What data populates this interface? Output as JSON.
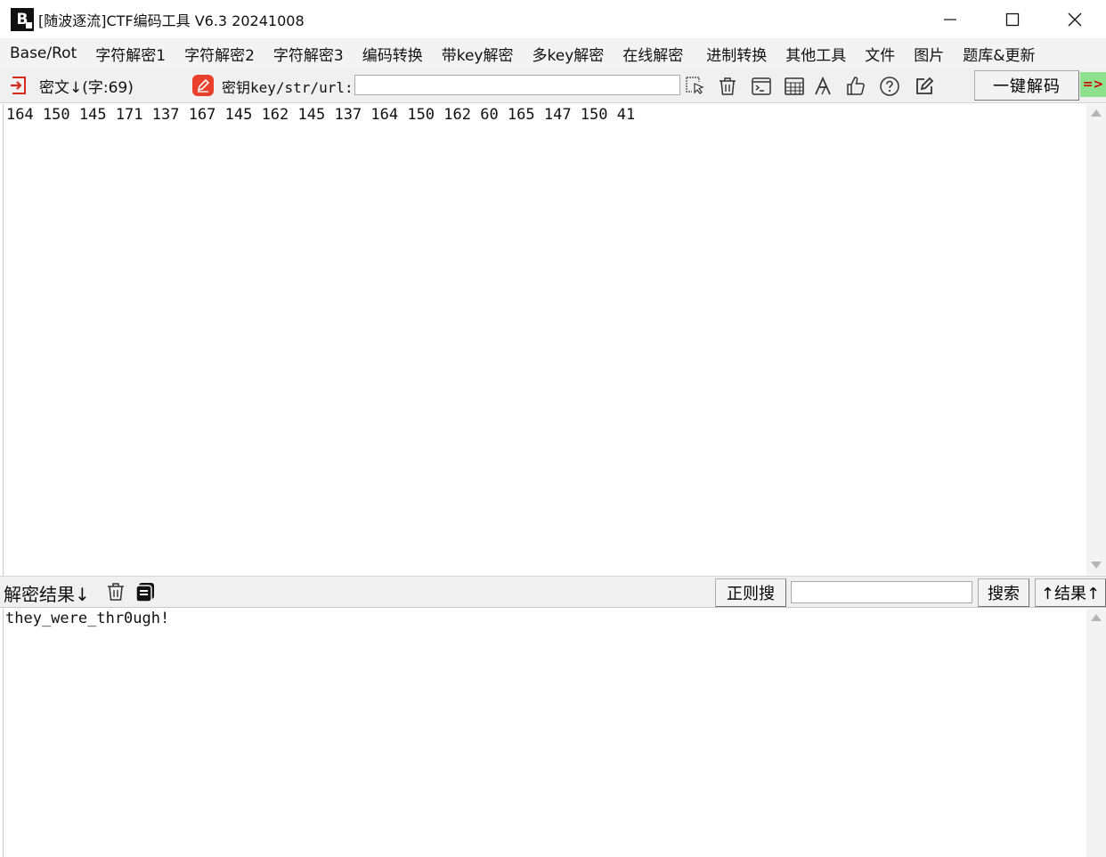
{
  "window": {
    "title": "[随波逐流]CTF编码工具 V6.3 20241008",
    "logo_text": "B"
  },
  "menu": {
    "items": [
      "Base/Rot",
      "字符解密1",
      "字符解密2",
      "字符解密3",
      "编码转换",
      "带key解密",
      "多key解密",
      "在线解密",
      "进制转换",
      "其他工具",
      "文件",
      "图片",
      "题库&更新"
    ]
  },
  "toolbar": {
    "cipher_label": "密文↓(字:69)",
    "key_label": "密钥key/str/url:",
    "key_value": "",
    "decode_button": "一键解码",
    "green_tag": "=>"
  },
  "cipher": {
    "text": "164 150 145 171 137 167 145 162 145 137 164 150 162 60 165 147 150 41"
  },
  "result": {
    "label": "解密结果↓",
    "regex_search_button": "正则搜",
    "search_value": "",
    "search_button": "搜索",
    "result_up_button": "↑结果↑",
    "text": "they_were_thr0ugh!"
  },
  "colors": {
    "accent_red": "#e8402a",
    "green_tag": "#8ee28e",
    "background": "#f0f0f0"
  }
}
